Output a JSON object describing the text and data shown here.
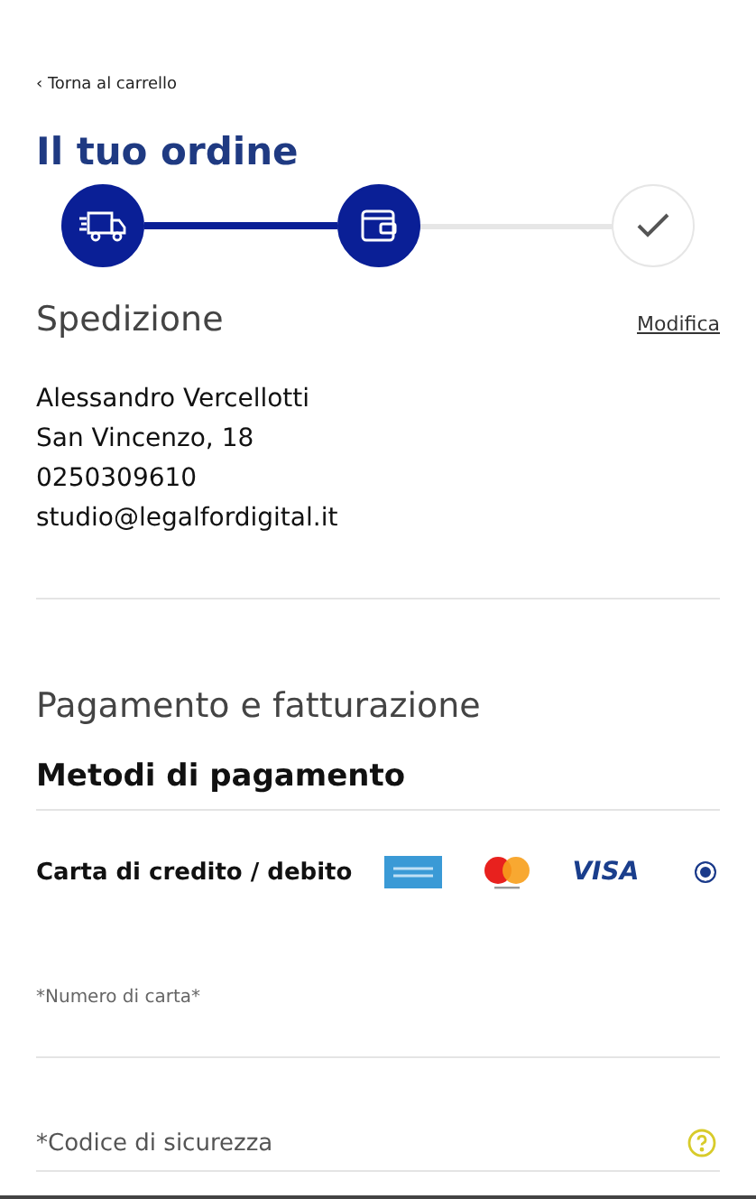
{
  "back_link": "‹ Torna al carrello",
  "title": "Il tuo ordine",
  "steps": [
    {
      "kind": "shipping",
      "done": true
    },
    {
      "kind": "payment",
      "done": true
    },
    {
      "kind": "confirm",
      "done": false
    }
  ],
  "shipping": {
    "heading": "Spedizione",
    "edit_link": "Modifica",
    "address_lines": [
      "Alessandro Vercellotti",
      "San Vincenzo, 18",
      "0250309610",
      "studio@legalfordigital.it"
    ]
  },
  "payment": {
    "heading": "Pagamento e fatturazione",
    "subheading": "Metodi di pagamento",
    "methods": [
      {
        "label": "Carta di credito / debito",
        "selected": true,
        "logos": [
          {
            "kind": "amex"
          },
          {
            "kind": "mastercard"
          },
          {
            "kind": "visa",
            "text": "VISA"
          }
        ]
      }
    ],
    "fields": [
      {
        "kind": "small",
        "placeholder": "*Numero di carta*",
        "help": false
      },
      {
        "kind": "large",
        "placeholder": "*Codice di sicurezza",
        "help": true
      }
    ]
  }
}
